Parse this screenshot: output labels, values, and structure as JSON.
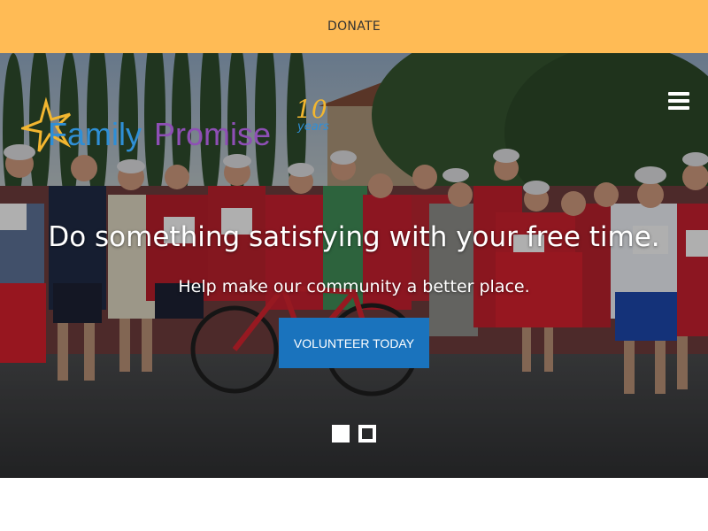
{
  "topbar": {
    "donate_label": "DONATE",
    "background": "#ffbb55"
  },
  "logo": {
    "brand_family": "Family",
    "brand_promise": "Promise",
    "anniversary_number": "10",
    "anniversary_word": "years",
    "star_icon": "star-icon",
    "colors": {
      "family": "#2f8fd6",
      "promise": "#8e4fb5",
      "accent": "#f2b630"
    }
  },
  "menu": {
    "icon": "hamburger-icon"
  },
  "hero": {
    "headline": "Do something satisfying with your free time.",
    "subheadline": "Help make our community a better place.",
    "cta_label": "VOLUNTEER TODAY",
    "cta_color": "#1a73bd",
    "photo_description_icon": "group-of-cyclists-photo"
  },
  "slider": {
    "slide_count": 2,
    "active_index": 0
  }
}
